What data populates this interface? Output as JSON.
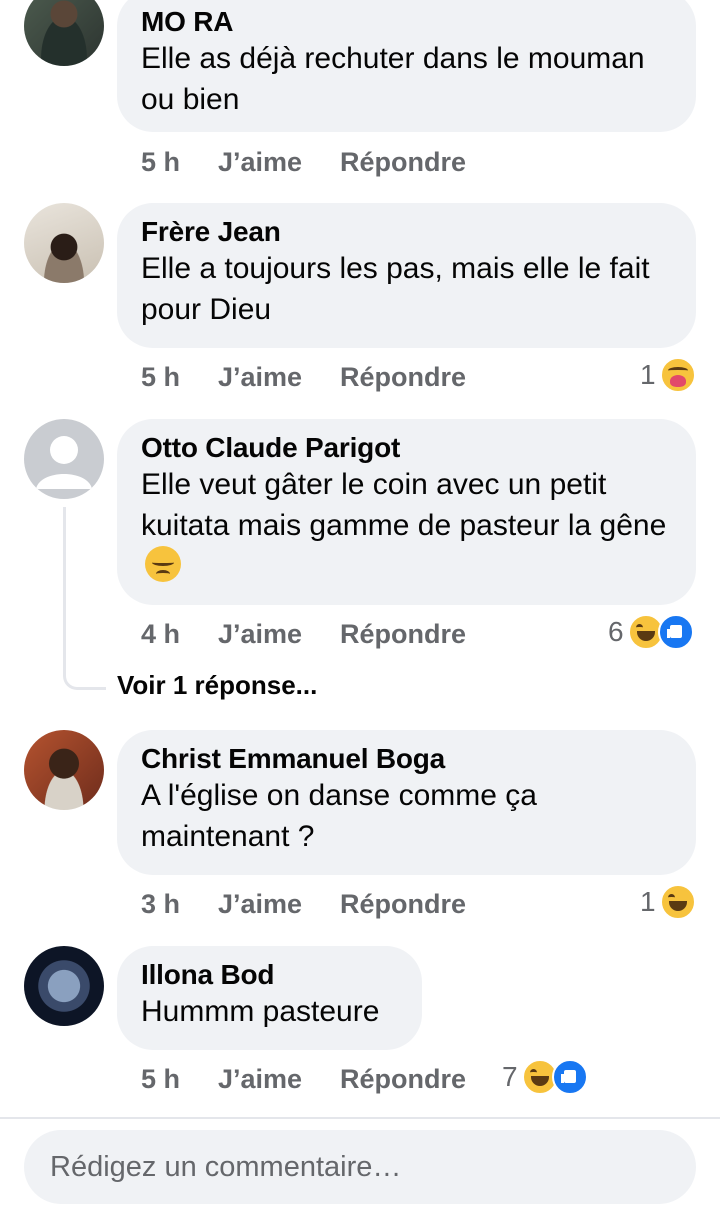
{
  "comments": [
    {
      "name": "MO RA",
      "text": "Elle as déjà rechuter dans le mouman ou bien",
      "time": "5 h",
      "like_label": "J’aime",
      "reply_label": "Répondre",
      "avatar": "avatar-photo"
    },
    {
      "name": "Frère Jean",
      "text": "Elle a toujours les pas, mais elle le fait pour Dieu",
      "time": "5 h",
      "like_label": "J’aime",
      "reply_label": "Répondre",
      "reaction_count": "1",
      "reactions": [
        "care"
      ],
      "avatar": "avatar-photo"
    },
    {
      "name": "Otto Claude Parigot",
      "text": "Elle veut gâter le coin avec un petit kuitata mais gamme de pasteur la gêne",
      "text_emoji": "disappointed-face",
      "time": "4 h",
      "like_label": "J’aime",
      "reply_label": "Répondre",
      "reaction_count": "6",
      "reactions": [
        "haha",
        "like"
      ],
      "avatar": "default-silhouette",
      "view_replies": "Voir 1 réponse..."
    },
    {
      "name": "Christ Emmanuel Boga",
      "text": "A l'église on danse comme ça maintenant ?",
      "time": "3 h",
      "like_label": "J’aime",
      "reply_label": "Répondre",
      "reaction_count": "1",
      "reactions": [
        "haha"
      ],
      "avatar": "avatar-photo"
    },
    {
      "name": "Illona Bod",
      "text": "Hummm pasteure",
      "time": "5 h",
      "like_label": "J’aime",
      "reply_label": "Répondre",
      "reaction_count": "7",
      "reactions": [
        "haha",
        "like"
      ],
      "avatar": "avatar-photo"
    }
  ],
  "composer": {
    "placeholder": "Rédigez un commentaire…"
  },
  "colors": {
    "bubble": "#f0f2f5",
    "meta_text": "#65676b",
    "like_blue": "#1877f2",
    "emoji_yellow": "#f7c33d"
  }
}
